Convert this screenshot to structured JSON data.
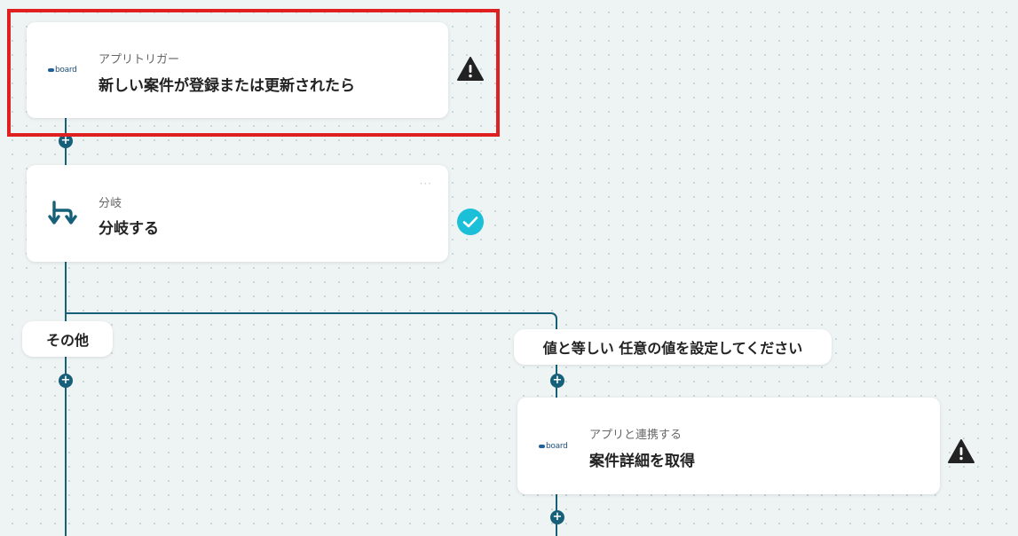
{
  "steps": {
    "trigger": {
      "category": "アプリトリガー",
      "title": "新しい案件が登録または更新されたら",
      "logo_text": "board",
      "status": "warning"
    },
    "branch": {
      "category": "分岐",
      "title": "分岐する",
      "status": "complete"
    },
    "action": {
      "category": "アプリと連携する",
      "title": "案件詳細を取得",
      "logo_text": "board",
      "status": "warning"
    }
  },
  "branches": {
    "other_label": "その他",
    "condition_label": "値と等しい 任意の値を設定してください"
  },
  "add_step_symbol": "+",
  "colors": {
    "connector": "#17607a",
    "highlight": "#e02020",
    "check": "#1bbfd8",
    "warning": "#222222"
  }
}
